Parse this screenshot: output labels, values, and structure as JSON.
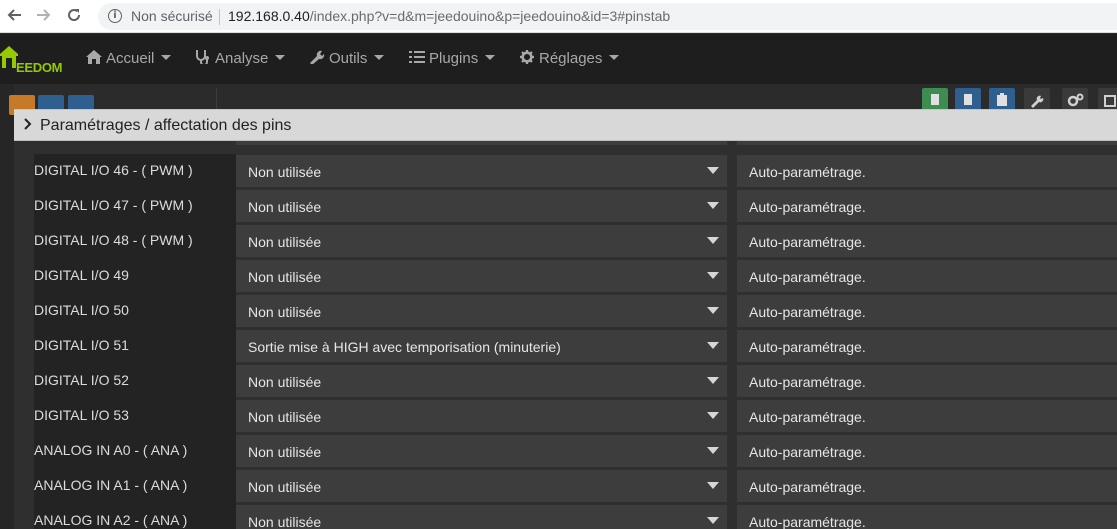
{
  "browser": {
    "security_label": "Non sécurisé",
    "url_host": "192.168.0.40",
    "url_path": "/index.php?v=d&m=jeedouino&p=jeedouino&id=3#pinstab"
  },
  "app": {
    "logo_text": "EEDOM",
    "nav": [
      {
        "label": "Accueil",
        "icon": "home-icon"
      },
      {
        "label": "Analyse",
        "icon": "stethoscope-icon"
      },
      {
        "label": "Outils",
        "icon": "wrench-icon"
      },
      {
        "label": "Plugins",
        "icon": "list-icon"
      },
      {
        "label": "Réglages",
        "icon": "gear-icon"
      }
    ]
  },
  "panel": {
    "title": "Paramétrages / affectation des pins",
    "rows": [
      {
        "label": "DIGITAL I/O 46 - ( PWM )",
        "mode": "Non utilisée",
        "param": "Auto-paramétrage."
      },
      {
        "label": "DIGITAL I/O 47 - ( PWM )",
        "mode": "Non utilisée",
        "param": "Auto-paramétrage."
      },
      {
        "label": "DIGITAL I/O 48 - ( PWM )",
        "mode": "Non utilisée",
        "param": "Auto-paramétrage."
      },
      {
        "label": "DIGITAL I/O 49",
        "mode": "Non utilisée",
        "param": "Auto-paramétrage."
      },
      {
        "label": "DIGITAL I/O 50",
        "mode": "Non utilisée",
        "param": "Auto-paramétrage."
      },
      {
        "label": "DIGITAL I/O 51",
        "mode": "Sortie mise à HIGH avec temporisation (minuterie)",
        "param": "Auto-paramétrage."
      },
      {
        "label": "DIGITAL I/O 52",
        "mode": "Non utilisée",
        "param": "Auto-paramétrage."
      },
      {
        "label": "DIGITAL I/O 53",
        "mode": "Non utilisée",
        "param": "Auto-paramétrage."
      },
      {
        "label": "ANALOG IN A0 - ( ANA )",
        "mode": "Non utilisée",
        "param": "Auto-paramétrage."
      },
      {
        "label": "ANALOG IN A1 - ( ANA )",
        "mode": "Non utilisée",
        "param": "Auto-paramétrage."
      },
      {
        "label": "ANALOG IN A2 - ( ANA )",
        "mode": "Non utilisée",
        "param": "Auto-paramétrage."
      }
    ]
  },
  "colors": {
    "brand": "#94ca02",
    "toolbar_green": "#3c8d4f",
    "toolbar_blue": "#2f5f8e",
    "sidebar_orange": "#c47a26"
  }
}
